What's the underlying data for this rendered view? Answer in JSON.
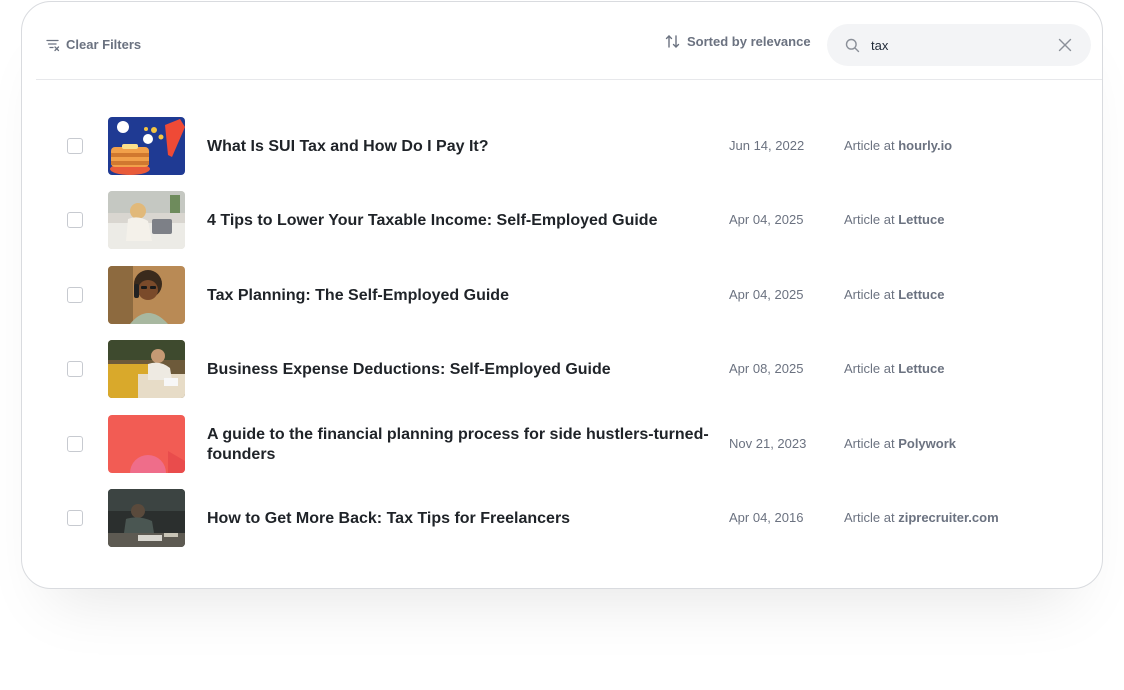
{
  "toolbar": {
    "clear_filters_label": "Clear Filters",
    "sort_label": "Sorted by relevance",
    "search_value": "tax"
  },
  "results": [
    {
      "title": "What Is SUI Tax and How Do I Pay It?",
      "date": "Jun 14, 2022",
      "type_label": "Article at",
      "source": "hourly.io",
      "thumb": "pancake-stack-illustration"
    },
    {
      "title": "4 Tips to Lower Your Taxable Income: Self-Employed Guide",
      "date": "Apr 04, 2025",
      "type_label": "Article at",
      "source": "Lettuce",
      "thumb": "woman-on-sofa-photo"
    },
    {
      "title": "Tax Planning: The Self-Employed Guide",
      "date": "Apr 04, 2025",
      "type_label": "Article at",
      "source": "Lettuce",
      "thumb": "man-on-phone-photo"
    },
    {
      "title": "Business Expense Deductions: Self-Employed Guide",
      "date": "Apr 08, 2025",
      "type_label": "Article at",
      "source": "Lettuce",
      "thumb": "person-at-table-photo"
    },
    {
      "title": "A guide to the financial planning process for side hustlers-turned-founders",
      "date": "Nov 21, 2023",
      "type_label": "Article at",
      "source": "Polywork",
      "thumb": "coral-abstract-illustration"
    },
    {
      "title": "How to Get More Back: Tax Tips for Freelancers",
      "date": "Apr 04, 2016",
      "type_label": "Article at",
      "source": "ziprecruiter.com",
      "thumb": "dark-desk-photo"
    }
  ],
  "colors": {
    "muted_text": "#6b7280",
    "title_text": "#1f2328",
    "search_bg": "#f3f4f6",
    "border": "#d9dbdf"
  }
}
